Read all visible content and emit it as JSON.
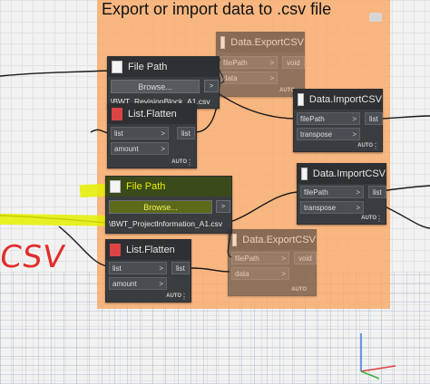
{
  "group": {
    "title": "Export or import data to .csv file"
  },
  "nodes": {
    "file_path_top": {
      "title": "File Path",
      "browse": "Browse...",
      "path": "\\BWT_RevisionBlock_A1.csv",
      "out": ">"
    },
    "export_top": {
      "title": "Data.ExportCSV",
      "in1": "filePath",
      "in2": "data",
      "out": "void",
      "auto": "AUTO"
    },
    "flatten_top": {
      "title": "List.Flatten",
      "in1": "list",
      "in2": "amount",
      "out": "list",
      "auto": "AUTO"
    },
    "import_top": {
      "title": "Data.ImportCSV",
      "in1": "filePath",
      "in2": "transpose",
      "out": "list",
      "auto": "AUTO"
    },
    "file_path_bottom": {
      "title": "File Path",
      "browse": "Browse...",
      "path": "\\BWT_ProjectInformation_A1.csv",
      "out": ">"
    },
    "import_bottom": {
      "title": "Data.ImportCSV",
      "in1": "filePath",
      "in2": "transpose",
      "out": "list",
      "auto": "AUTO"
    },
    "flatten_bottom": {
      "title": "List.Flatten",
      "in1": "list",
      "in2": "amount",
      "out": "list",
      "auto": "AUTO"
    },
    "export_bottom": {
      "title": "Data.ExportCSV",
      "in1": "filePath",
      "in2": "data",
      "out": "void",
      "auto": "AUTO"
    }
  },
  "annotation": {
    "text": "CSV",
    "color": "#e12d2d"
  },
  "colors": {
    "group_bg": "#f9a868",
    "node_bg": "#3a3d40",
    "highlight": "#e6f000"
  }
}
